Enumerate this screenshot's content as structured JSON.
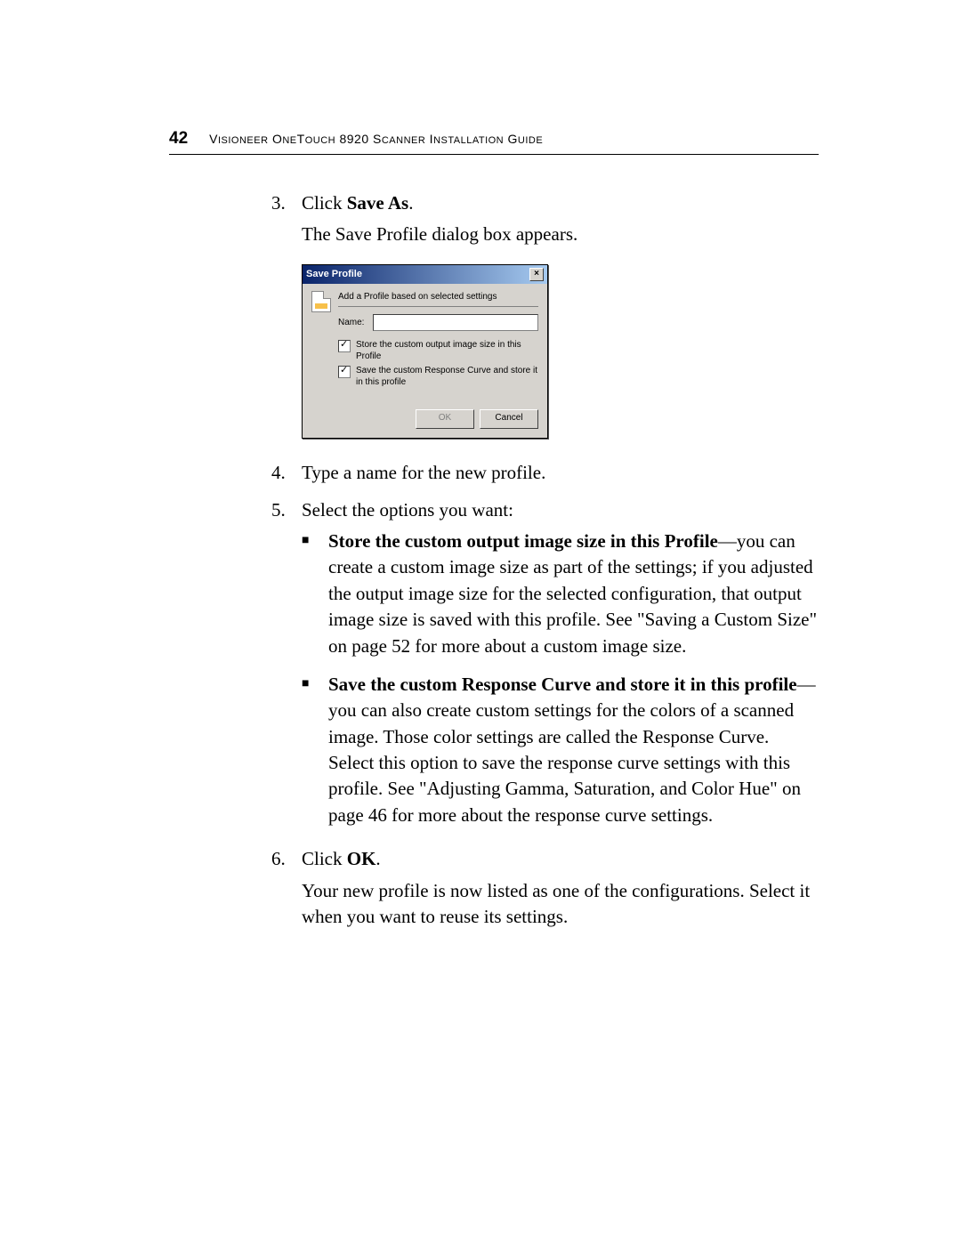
{
  "header": {
    "page_number": "42",
    "title_prefix": "V",
    "title_rest1": "ISIONEER",
    "title_mid1": " O",
    "title_rest2": "NE",
    "title_mid2": "T",
    "title_rest3": "OUCH",
    "title_tail": " 8920 S",
    "title_rest4": "CANNER",
    "title_mid3": " I",
    "title_rest5": "NSTALLATION",
    "title_mid4": " G",
    "title_rest6": "UIDE"
  },
  "steps": {
    "s3": {
      "num": "3.",
      "text_a": "Click ",
      "bold": "Save As",
      "text_b": ".",
      "sub": "The Save Profile dialog box appears."
    },
    "s4": {
      "num": "4.",
      "text": "Type a name for the new profile."
    },
    "s5": {
      "num": "5.",
      "text": "Select the options you want:"
    },
    "s6": {
      "num": "6.",
      "text_a": "Click ",
      "bold": "OK",
      "text_b": ".",
      "follow": "Your new profile is now listed as one of the configurations. Select it when you want to reuse its settings."
    }
  },
  "bullets": {
    "b1": {
      "bold": "Store the custom output image size in this Profile",
      "rest": "—you can create a custom image size as part of the settings; if you adjusted the output image size for the selected configuration, that output image size is saved with this profile. See \"Saving a Custom Size\" on page 52 for more about a custom image size."
    },
    "b2": {
      "bold": "Save the custom Response Curve and store it in this profile",
      "rest": "—you can also create custom settings for the colors of a scanned image. Those color settings are called the Response Curve. Select this option to save the response curve settings with this profile. See \"Adjusting Gamma, Saturation, and Color Hue\" on page 46 for more about the response curve settings."
    }
  },
  "dialog": {
    "title": "Save Profile",
    "close": "×",
    "heading": "Add a Profile based on selected settings",
    "name_label": "Name:",
    "chk1": "Store the custom output image size in this Profile",
    "chk2": "Save the custom Response Curve and store it in this profile",
    "ok": "OK",
    "cancel": "Cancel"
  }
}
